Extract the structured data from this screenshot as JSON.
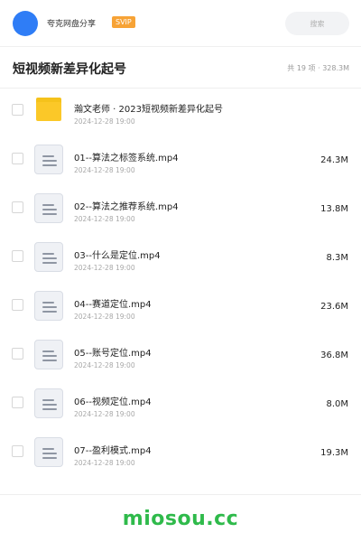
{
  "header": {
    "username": "夸克网盘分享",
    "badge": "SVIP",
    "search_placeholder": "搜索"
  },
  "title_bar": {
    "title": "短视频新差异化起号",
    "meta": "共 19 项 · 328.3M"
  },
  "items": [
    {
      "type": "folder",
      "name": "瀚文老师 · 2023短视频新差异化起号",
      "date": "2024-12-28 19:00",
      "size": ""
    },
    {
      "type": "file",
      "name": "01--算法之标签系统.mp4",
      "date": "2024-12-28 19:00",
      "size": "24.3M"
    },
    {
      "type": "file",
      "name": "02--算法之推荐系统.mp4",
      "date": "2024-12-28 19:00",
      "size": "13.8M"
    },
    {
      "type": "file",
      "name": "03--什么是定位.mp4",
      "date": "2024-12-28 19:00",
      "size": "8.3M"
    },
    {
      "type": "file",
      "name": "04--赛道定位.mp4",
      "date": "2024-12-28 19:00",
      "size": "23.6M"
    },
    {
      "type": "file",
      "name": "05--账号定位.mp4",
      "date": "2024-12-28 19:00",
      "size": "36.8M"
    },
    {
      "type": "file",
      "name": "06--视频定位.mp4",
      "date": "2024-12-28 19:00",
      "size": "8.0M"
    },
    {
      "type": "file",
      "name": "07--盈利模式.mp4",
      "date": "2024-12-28 19:00",
      "size": "19.3M"
    }
  ],
  "watermark": "miosou.cc",
  "colors": {
    "accent_blue": "#2f7df6",
    "svip_orange": "#f7a336",
    "folder_yellow": "#fbc828",
    "watermark_green": "#2fba4b"
  }
}
